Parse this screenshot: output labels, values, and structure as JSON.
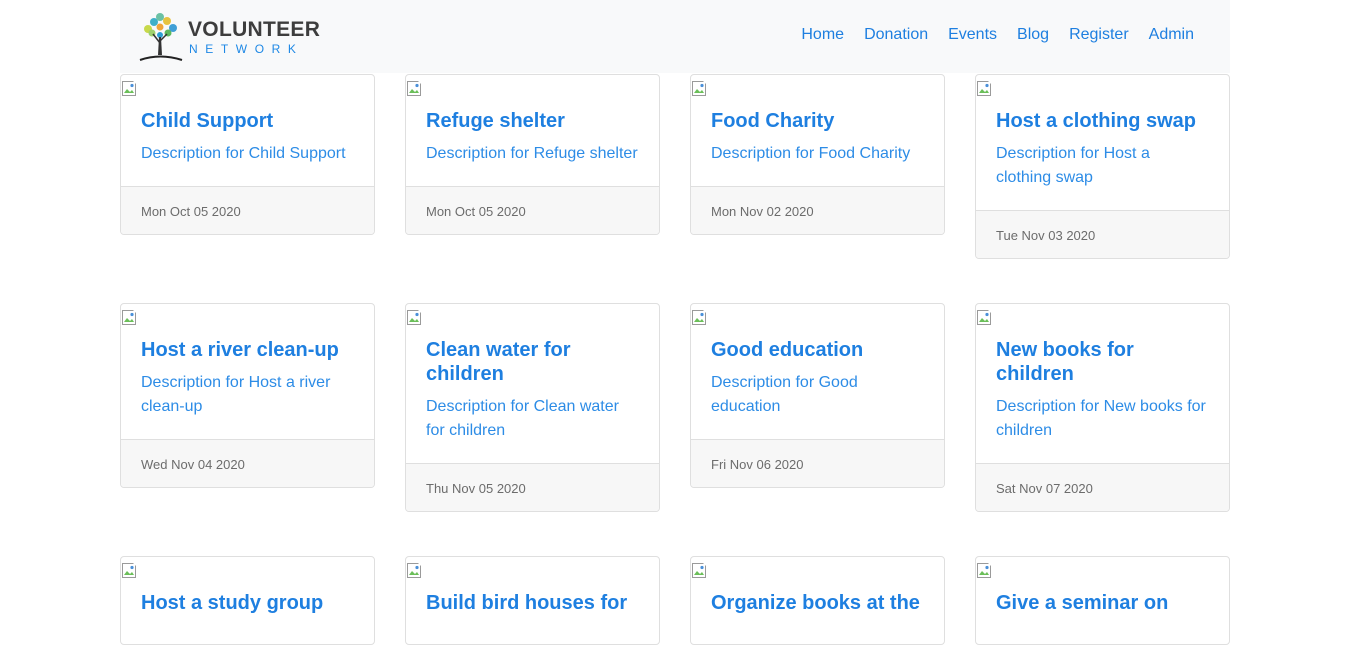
{
  "brand": {
    "name": "VOLUNTEER",
    "tagline": "NETWORK"
  },
  "nav": {
    "items": [
      "Home",
      "Donation",
      "Events",
      "Blog",
      "Register",
      "Admin"
    ]
  },
  "events": [
    {
      "title": "Child Support",
      "description": "Description for Child Support",
      "date": "Mon Oct 05 2020"
    },
    {
      "title": "Refuge shelter",
      "description": "Description for Refuge shelter",
      "date": "Mon Oct 05 2020"
    },
    {
      "title": "Food Charity",
      "description": "Description for Food Charity",
      "date": "Mon Nov 02 2020"
    },
    {
      "title": "Host a clothing swap",
      "description": "Description for Host a clothing swap",
      "date": "Tue Nov 03 2020"
    },
    {
      "title": "Host a river clean-up",
      "description": "Description for Host a river clean-up",
      "date": "Wed Nov 04 2020"
    },
    {
      "title": "Clean water for children",
      "description": "Description for Clean water for children",
      "date": "Thu Nov 05 2020"
    },
    {
      "title": "Good education",
      "description": "Description for Good education",
      "date": "Fri Nov 06 2020"
    },
    {
      "title": "New books for children",
      "description": "Description for New books for children",
      "date": "Sat Nov 07 2020"
    },
    {
      "title": "Host a study group",
      "description": "",
      "date": ""
    },
    {
      "title": "Build bird houses for",
      "description": "",
      "date": ""
    },
    {
      "title": "Organize books at the",
      "description": "",
      "date": ""
    },
    {
      "title": "Give a seminar on",
      "description": "",
      "date": ""
    }
  ]
}
